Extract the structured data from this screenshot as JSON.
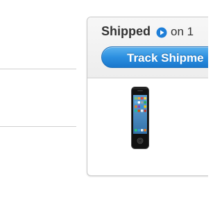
{
  "shipment": {
    "status": "Shipped",
    "date_prefix": "on 1",
    "track_button_label": "Track Shipme",
    "product_image": "iphone-black"
  },
  "colors": {
    "button_blue": "#2c8fe0",
    "icon_blue": "#1f7fd8",
    "divider": "#cfcfcf"
  }
}
